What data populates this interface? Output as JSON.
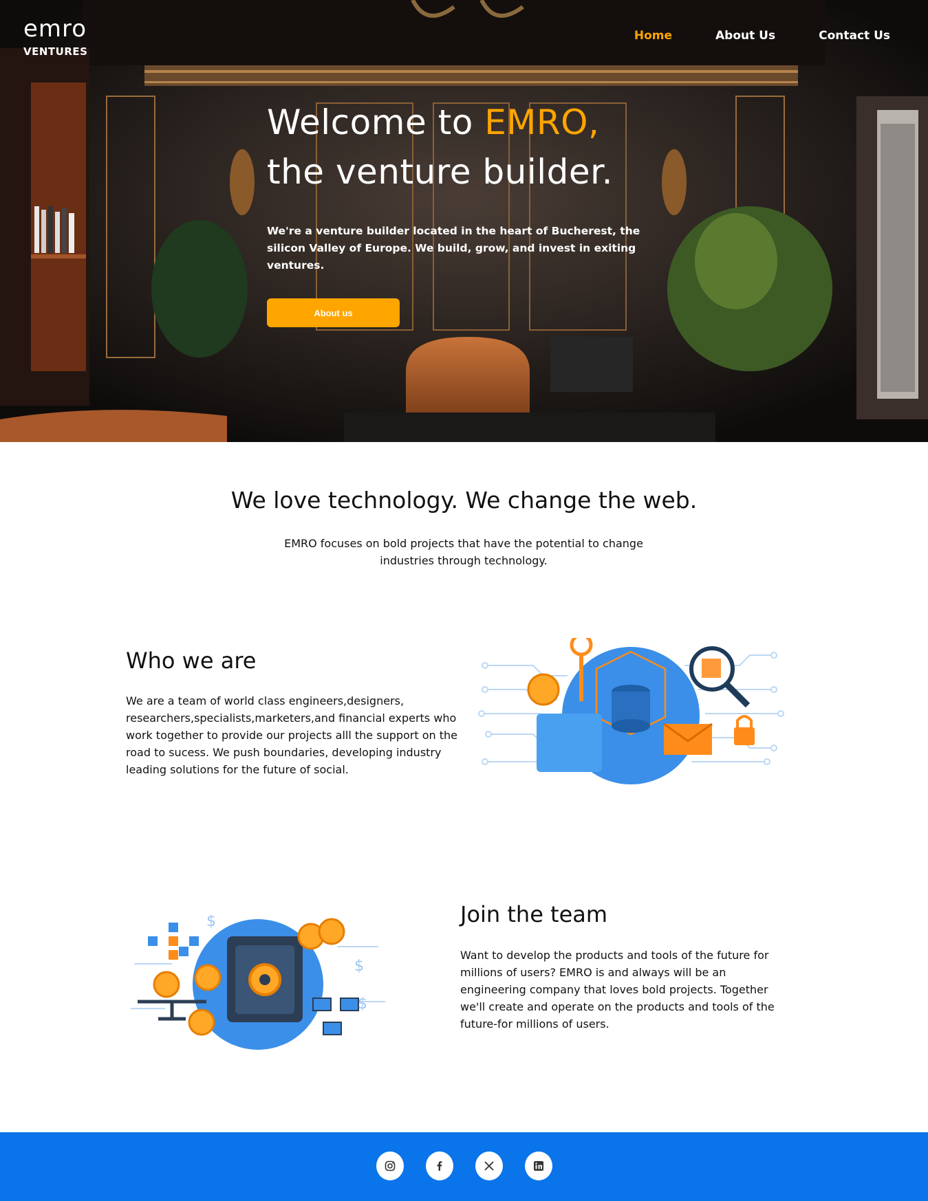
{
  "brand": {
    "word": "emro",
    "sub": "VENTURES"
  },
  "nav": {
    "home": "Home",
    "about": "About Us",
    "contact": "Contact Us"
  },
  "hero": {
    "title_prefix": "Welcome to ",
    "title_accent": "EMRO,",
    "title_line2": "the venture builder.",
    "description": "We're a venture builder located in the heart of Bucherest, the silicon Valley of Europe. We build, grow, and invest in exiting ventures.",
    "button_label": "About us"
  },
  "intro": {
    "title": "We love technology. We change the web.",
    "text": "EMRO focuses on bold projects that have the potential to change industries through technology."
  },
  "who": {
    "title": "Who we are",
    "text": "We are a team of world class engineers,designers, researchers,specialists,marketers,and financial experts who work together to provide our projects alll the support on the road to sucess. We push boundaries, developing industry leading solutions for the future of social."
  },
  "join": {
    "title": "Join the team",
    "text": "Want to develop the products and tools of the future for millions of users? EMRO is and always will be an engineering company that loves bold projects. Together we'll create and operate on the products and tools of the future-for millions of users."
  },
  "footer": {
    "socials": [
      "instagram-icon",
      "facebook-icon",
      "x-twitter-icon",
      "linkedin-icon"
    ]
  },
  "colors": {
    "accent": "#ffa500",
    "footer_blue": "#0a74ea",
    "illustration_blue": "#3b8fe8"
  }
}
